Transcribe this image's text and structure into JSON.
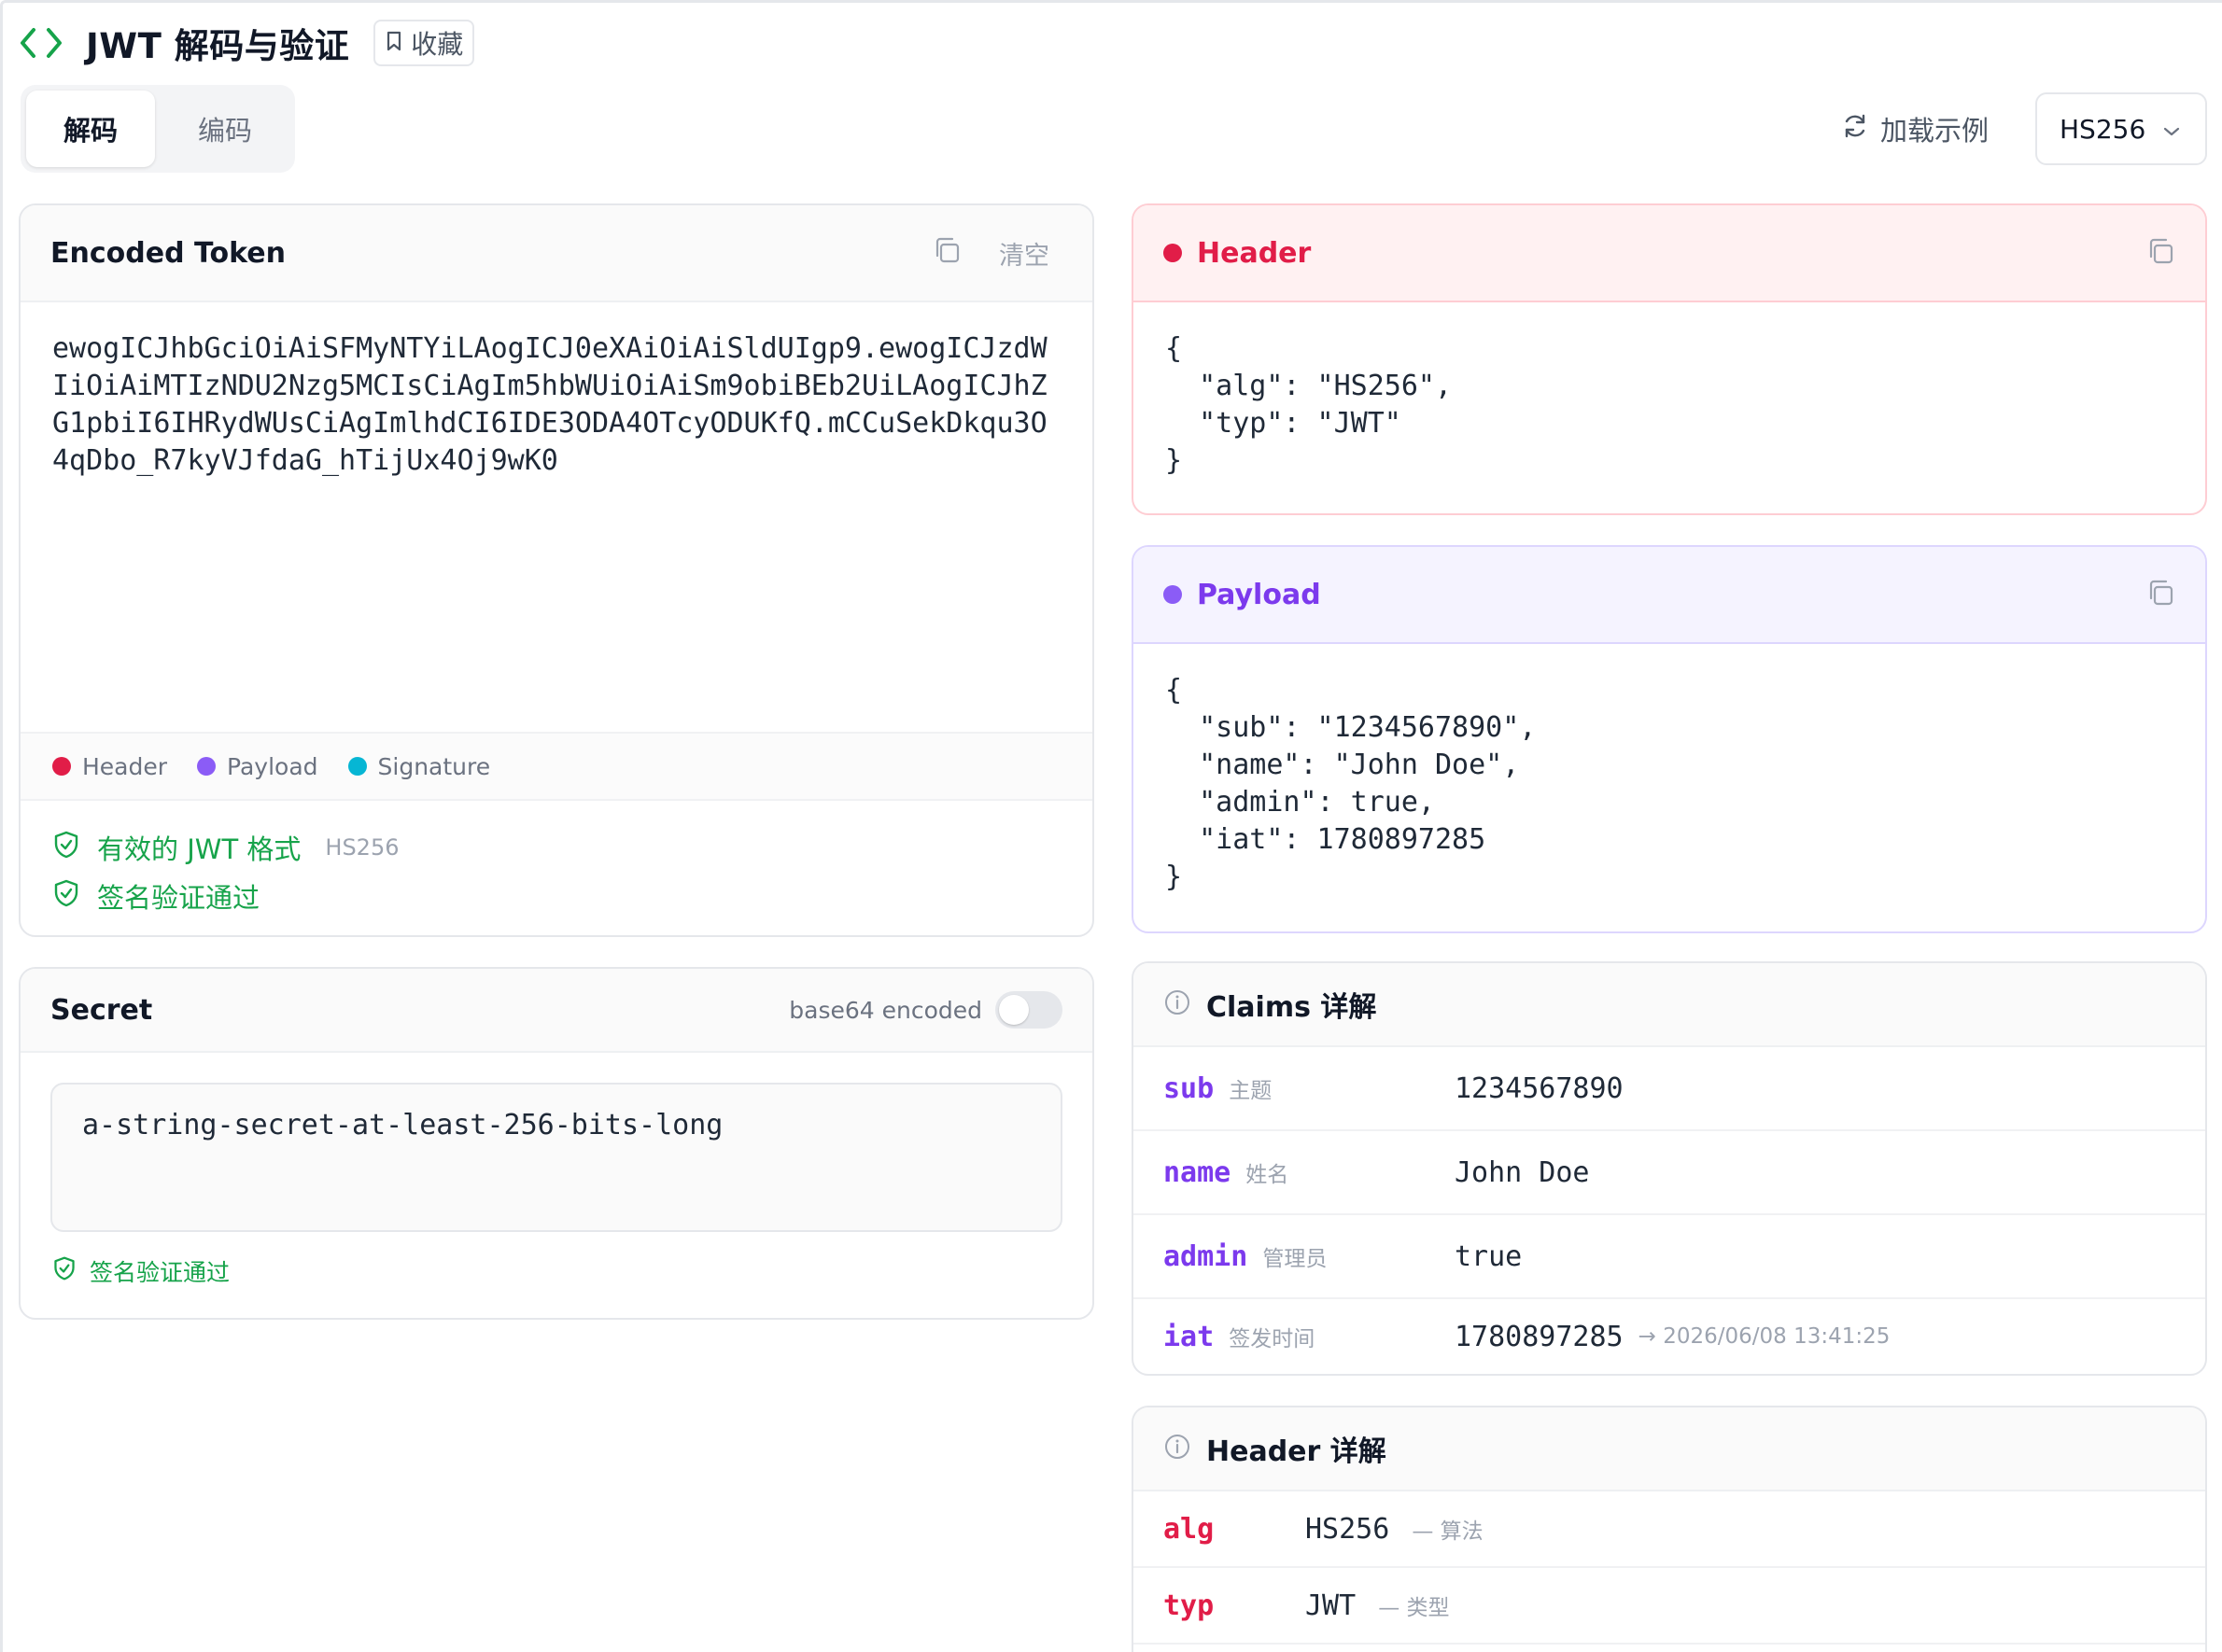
{
  "app": {
    "title": "JWT 解码与验证",
    "favorite_label": "收藏"
  },
  "tabs": [
    {
      "label": "解码",
      "active": true
    },
    {
      "label": "编码",
      "active": false
    }
  ],
  "toolbar": {
    "load_example_label": "加载示例",
    "algorithm_selected": "HS256"
  },
  "encoded_token": {
    "title": "Encoded Token",
    "clear_label": "清空",
    "value": "ewogICJhbGciOiAiSFMyNTYiLAogICJ0eXAiOiAiSldUIgp9.ewogICJzdWIiOiAiMTIzNDU2Nzg5MCIsCiAgIm5hbWUiOiAiSm9obiBEb2UiLAogICJhZG1pbiI6IHRydWUsCiAgImlhdCI6IDE3ODA4OTcyODUKfQ.mCCuSekDkqu3O4qDbo_R7kyVJfdaG_hTijUx4Oj9wK0",
    "legend": [
      {
        "label": "Header",
        "color": "#e11d48"
      },
      {
        "label": "Payload",
        "color": "#8b5cf6"
      },
      {
        "label": "Signature",
        "color": "#06b6d4"
      }
    ],
    "status": [
      {
        "text": "有效的 JWT 格式",
        "sub": "HS256"
      },
      {
        "text": "签名验证通过",
        "sub": ""
      }
    ]
  },
  "secret": {
    "title": "Secret",
    "base64_label": "base64 encoded",
    "base64_enabled": false,
    "value": "a-string-secret-at-least-256-bits-long",
    "status": "签名验证通过"
  },
  "header_section": {
    "title": "Header",
    "color": "#e11d48",
    "json": "{\n  \"alg\": \"HS256\",\n  \"typ\": \"JWT\"\n}"
  },
  "payload_section": {
    "title": "Payload",
    "color": "#8b5cf6",
    "json": "{\n  \"sub\": \"1234567890\",\n  \"name\": \"John Doe\",\n  \"admin\": true,\n  \"iat\": 1780897285\n}"
  },
  "claims": {
    "title": "Claims 详解",
    "rows": [
      {
        "key": "sub",
        "desc": "主题",
        "value": "1234567890",
        "extra": ""
      },
      {
        "key": "name",
        "desc": "姓名",
        "value": "John Doe",
        "extra": ""
      },
      {
        "key": "admin",
        "desc": "管理员",
        "value": "true",
        "extra": ""
      },
      {
        "key": "iat",
        "desc": "签发时间",
        "value": "1780897285",
        "extra": "→ 2026/06/08 13:41:25"
      }
    ]
  },
  "header_details": {
    "title": "Header 详解",
    "rows": [
      {
        "key": "alg",
        "value": "HS256",
        "desc": "— 算法"
      },
      {
        "key": "typ",
        "value": "JWT",
        "desc": "— 类型"
      }
    ]
  },
  "colors": {
    "accent_green": "#16a34a",
    "header_red": "#e11d48",
    "payload_purple": "#8b5cf6",
    "signature_cyan": "#06b6d4"
  }
}
